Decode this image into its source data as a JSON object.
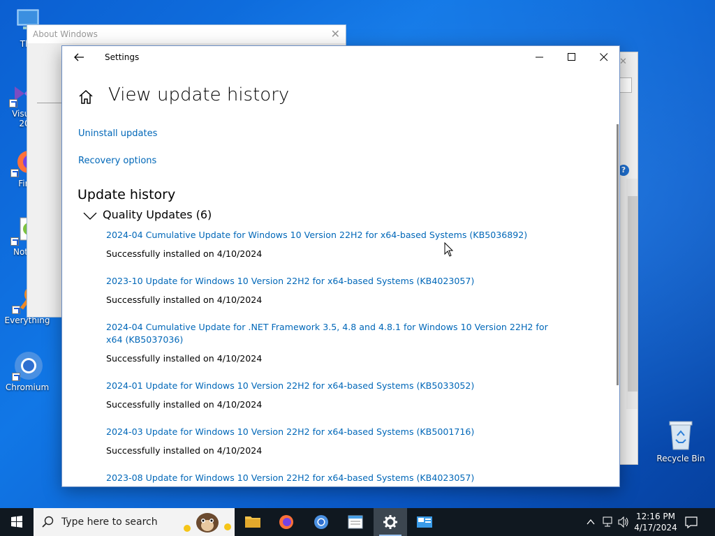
{
  "desktop": {
    "icons": [
      {
        "label": "This",
        "name": "this-pc"
      },
      {
        "label": "Visual\n20",
        "name": "visual-studio"
      },
      {
        "label": "Fire",
        "name": "firefox"
      },
      {
        "label": "Notep",
        "name": "notepad"
      },
      {
        "label": "Everything",
        "name": "everything"
      },
      {
        "label": "Chromium",
        "name": "chromium"
      }
    ],
    "recycle_bin_label": "Recycle Bin"
  },
  "about_window": {
    "title": "About Windows"
  },
  "settings": {
    "title": "Settings",
    "page_title": "View update history",
    "links": {
      "uninstall": "Uninstall updates",
      "recovery": "Recovery options"
    },
    "section_title": "Update history",
    "group_label": "Quality Updates (6)",
    "updates": [
      {
        "title": "2024-04 Cumulative Update for Windows 10 Version 22H2 for x64-based Systems (KB5036892)",
        "status": "Successfully installed on 4/10/2024"
      },
      {
        "title": "2023-10 Update for Windows 10 Version 22H2 for x64-based Systems (KB4023057)",
        "status": "Successfully installed on 4/10/2024"
      },
      {
        "title": "2024-04 Cumulative Update for .NET Framework 3.5, 4.8 and 4.8.1 for Windows 10 Version 22H2 for x64 (KB5037036)",
        "status": "Successfully installed on 4/10/2024"
      },
      {
        "title": "2024-01 Update for Windows 10 Version 22H2 for x64-based Systems (KB5033052)",
        "status": "Successfully installed on 4/10/2024"
      },
      {
        "title": "2024-03 Update for Windows 10 Version 22H2 for x64-based Systems (KB5001716)",
        "status": "Successfully installed on 4/10/2024"
      },
      {
        "title": "2023-08 Update for Windows 10 Version 22H2 for x64-based Systems (KB4023057)",
        "status": ""
      }
    ]
  },
  "taskbar": {
    "search_placeholder": "Type here to search",
    "time": "12:16 PM",
    "date": "4/17/2024",
    "apps": [
      "file-explorer",
      "firefox",
      "chromium",
      "notepad",
      "settings",
      "control-panel"
    ],
    "active_app": "settings"
  },
  "colors": {
    "link": "#0067b8",
    "taskbar": "#101820",
    "desktop": "#0b5fd1"
  }
}
